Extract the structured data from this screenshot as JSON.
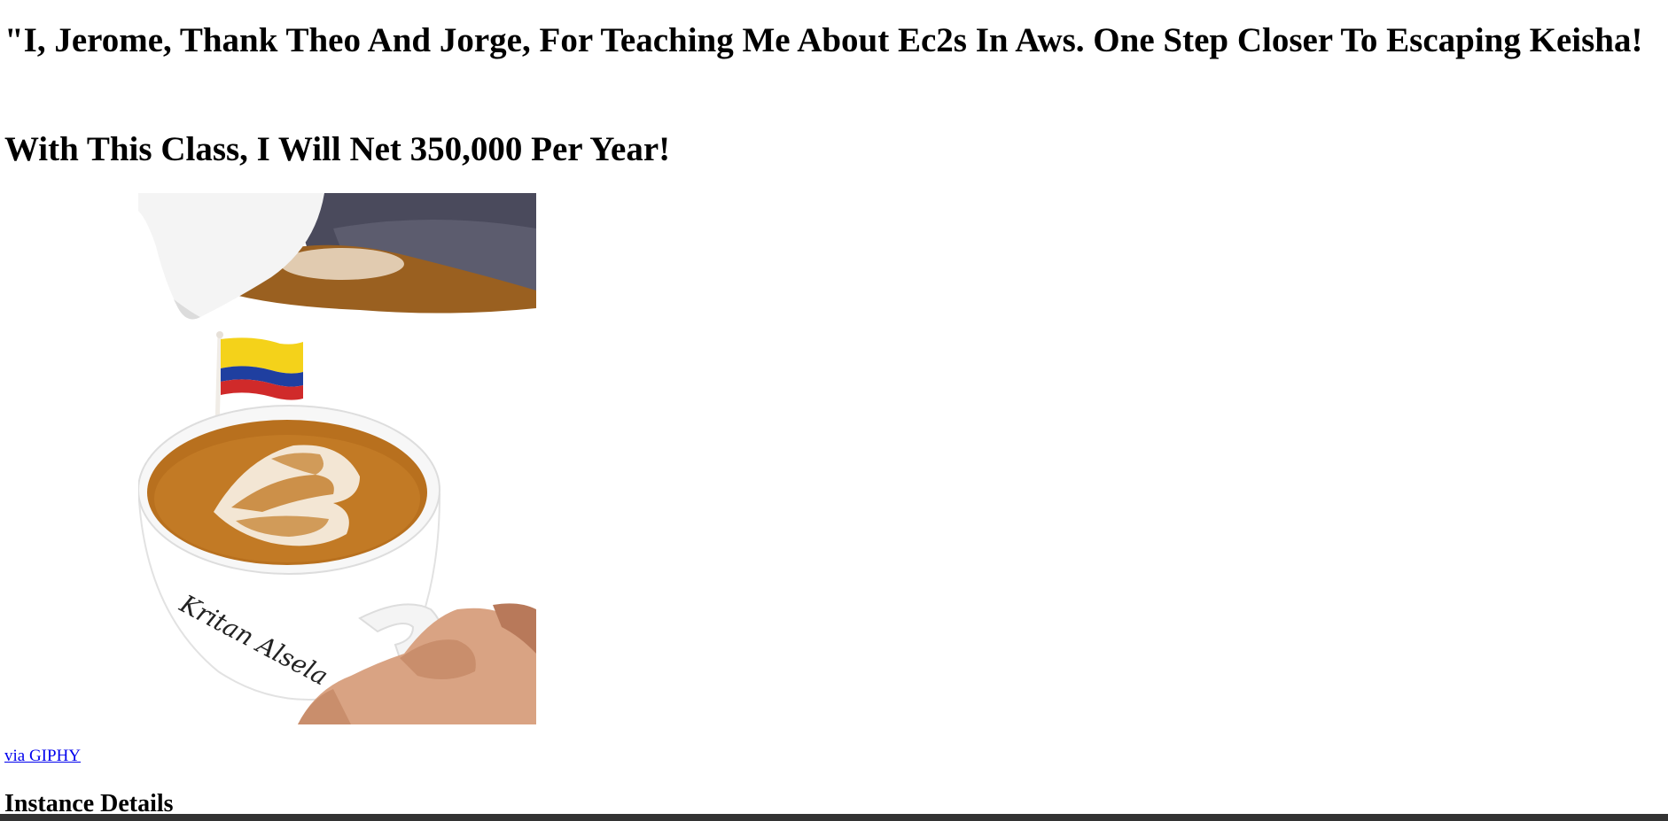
{
  "page": {
    "heading_main": "\"I, Jerome, Thank Theo And Jorge, For Teaching Me About Ec2s In Aws. One Step Closer To Escaping Keisha!",
    "heading_sub": "With This Class, I Will Net 350,000 Per Year!",
    "gif_link_label": "via GIPHY",
    "section_heading": "Instance Details"
  },
  "gif": {
    "icon": "latte-art-colombian-flag-gif",
    "cup_text": "Kritan Alsela"
  },
  "colors": {
    "link": "#0000ee",
    "flag_yellow": "#f4d21a",
    "flag_blue": "#1f3fa0",
    "flag_red": "#d02a2a",
    "coffee": "#b8701e"
  }
}
